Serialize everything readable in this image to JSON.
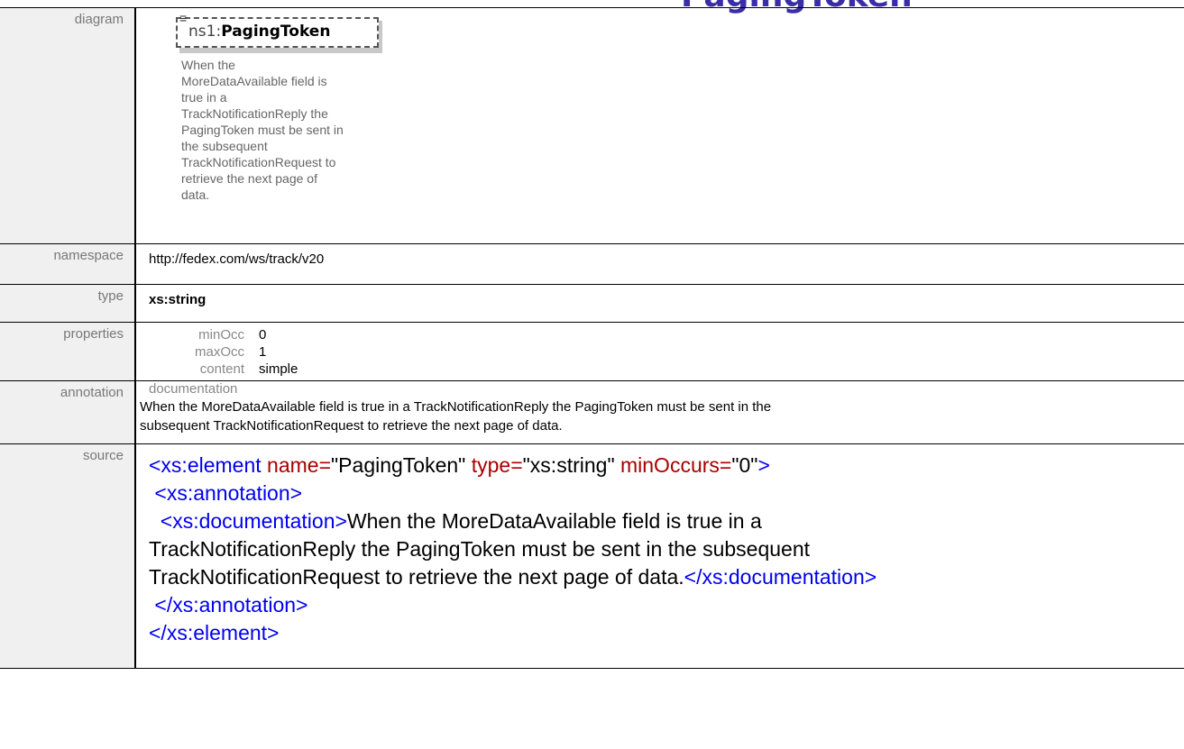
{
  "page_title": "PagingToken",
  "rows": {
    "diagram": {
      "label": "diagram",
      "element_ns": "ns1:",
      "element_name": "PagingToken",
      "doc_lines": [
        "When the",
        "MoreDataAvailable field is",
        "true in a",
        "TrackNotificationReply the",
        "PagingToken must be sent in",
        "the subsequent",
        "TrackNotificationRequest to",
        "retrieve the next page of",
        "data."
      ]
    },
    "namespace": {
      "label": "namespace",
      "value": "http://fedex.com/ws/track/v20"
    },
    "type": {
      "label": "type",
      "value": "xs:string"
    },
    "properties": {
      "label": "properties",
      "items": [
        {
          "key": "minOcc",
          "value": "0"
        },
        {
          "key": "maxOcc",
          "value": "1"
        },
        {
          "key": "content",
          "value": "simple"
        }
      ]
    },
    "annotation": {
      "label": "annotation",
      "heading": "documentation",
      "text_line1": "When the MoreDataAvailable field is true in a TrackNotificationReply the PagingToken must be sent in the",
      "text_line2": "subsequent TrackNotificationRequest to retrieve the next page of data."
    },
    "source": {
      "label": "source",
      "l1_open": "<xs:element",
      "l1_attr1": " name=",
      "l1_val1": "\"PagingToken\"",
      "l1_attr2": " type=",
      "l1_val2": "\"xs:string\"",
      "l1_attr3": " minOccurs=",
      "l1_val3": "\"0\"",
      "l1_close": ">",
      "l2": " <xs:annotation>",
      "l3_open": "  <xs:documentation>",
      "l3_text": "When the MoreDataAvailable field is true in a",
      "l4_text": "TrackNotificationReply the PagingToken must be sent in the subsequent",
      "l5_text": "TrackNotificationRequest to retrieve the next page of data.",
      "l5_close": "</xs:documentation>",
      "l6": " </xs:annotation>",
      "l7": "</xs:element>"
    }
  },
  "colors": {
    "title": "#3a2ea8",
    "label_bg": "#f0f0f0",
    "tag": "#0000ee",
    "attr": "#aa0000"
  }
}
